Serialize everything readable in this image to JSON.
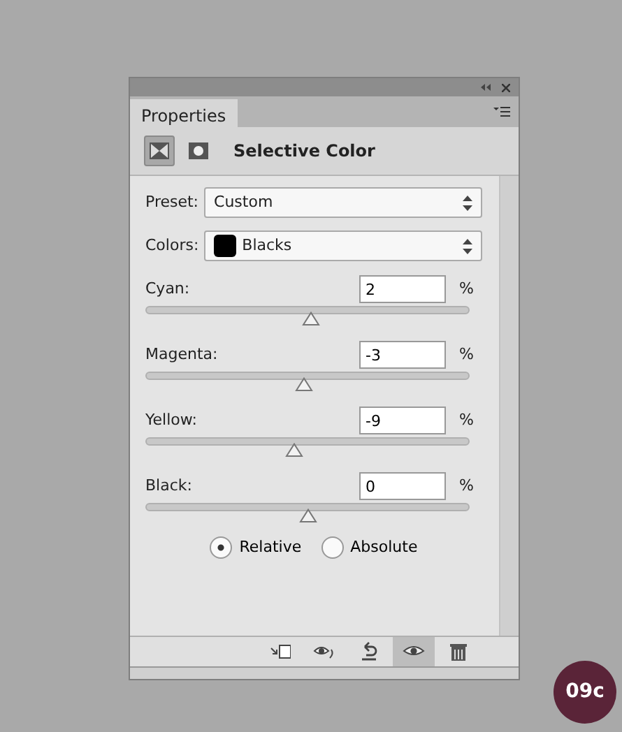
{
  "panel": {
    "tab": "Properties",
    "title": "Selective Color",
    "header_icons": [
      {
        "kind": "adjustment",
        "selected": true
      },
      {
        "kind": "mask",
        "selected": false
      }
    ],
    "preset": {
      "label": "Preset:",
      "value": "Custom"
    },
    "colors": {
      "label": "Colors:",
      "value": "Blacks",
      "color": "#000000"
    },
    "sliders": [
      {
        "label": "Cyan:",
        "value": "2",
        "unit": "%",
        "level": 0.51
      },
      {
        "label": "Magenta:",
        "value": "-3",
        "unit": "%",
        "level": 0.485
      },
      {
        "label": "Yellow:",
        "value": "-9",
        "unit": "%",
        "level": 0.455
      },
      {
        "label": "Black:",
        "value": "0",
        "unit": "%",
        "level": 0.5
      }
    ],
    "method": [
      {
        "label": "Relative",
        "selected": true
      },
      {
        "label": "Absolute",
        "selected": false
      }
    ],
    "footer_buttons": [
      {
        "kind": "clip",
        "pressed": false
      },
      {
        "kind": "view-previous",
        "pressed": false
      },
      {
        "kind": "reset",
        "pressed": false
      },
      {
        "kind": "visibility",
        "pressed": true
      },
      {
        "kind": "delete",
        "pressed": false
      }
    ]
  },
  "figure_label": "09c"
}
